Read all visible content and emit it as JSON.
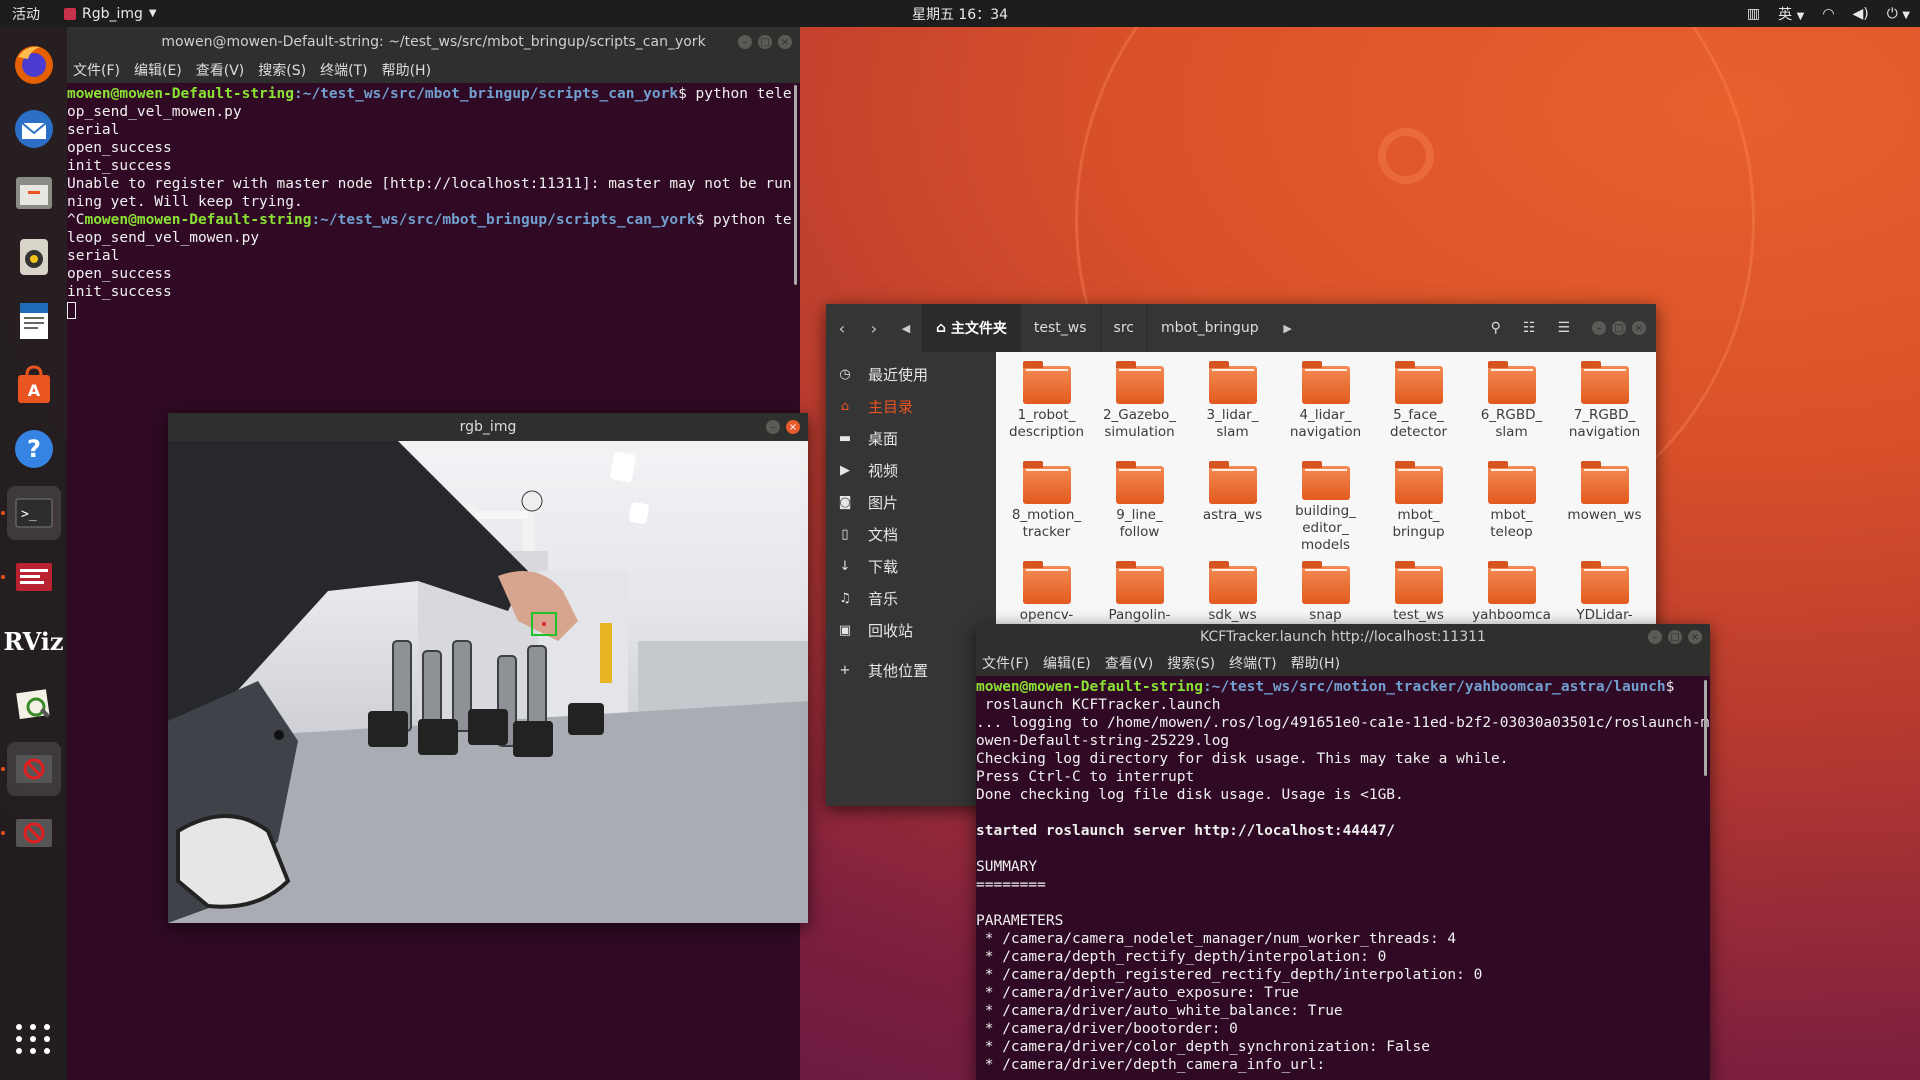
{
  "topbar": {
    "activities": "活动",
    "app_name": "Rgb_img",
    "clock": "星期五 16：34",
    "input_method": "英"
  },
  "dock": {
    "items": [
      "firefox-icon",
      "thunderbird-icon",
      "files-icon",
      "rhythmbox-icon",
      "writer-icon",
      "software-icon",
      "help-icon",
      "terminal-icon",
      "terminal-red-icon",
      "rviz-icon",
      "image-viewer-icon",
      "blocked-app-icon",
      "blocked-app-icon"
    ],
    "rviz_label": "RViz"
  },
  "terminal1": {
    "title": "mowen@mowen-Default-string: ~/test_ws/src/mbot_bringup/scripts_can_york",
    "menu": [
      "文件(F)",
      "编辑(E)",
      "查看(V)",
      "搜索(S)",
      "终端(T)",
      "帮助(H)"
    ],
    "prompt_user": "mowen@mowen-Default-string",
    "prompt_path": ":~/test_ws/src/mbot_bringup/scripts_can_york",
    "cmd1": "$ python teleop_send_vel_mowen.py",
    "lines1": [
      "serial",
      "open_success",
      "init_success",
      "Unable to register with master node [http://localhost:11311]: master may not be running yet. Will keep trying."
    ],
    "ctrl_c": "^C",
    "cmd2": "$ python teleop_send_vel_mowen.py",
    "lines2": [
      "serial",
      "open_success",
      "init_success"
    ]
  },
  "image_window": {
    "title": "rgb_img"
  },
  "files": {
    "breadcrumbs": [
      "主文件夹",
      "test_ws",
      "src",
      "mbot_bringup"
    ],
    "sidebar": [
      {
        "icon": "clock-icon",
        "label": "最近使用"
      },
      {
        "icon": "home-icon",
        "label": "主目录"
      },
      {
        "icon": "folder-icon",
        "label": "桌面"
      },
      {
        "icon": "video-icon",
        "label": "视频"
      },
      {
        "icon": "camera-icon",
        "label": "图片"
      },
      {
        "icon": "document-icon",
        "label": "文档"
      },
      {
        "icon": "download-icon",
        "label": "下载"
      },
      {
        "icon": "music-icon",
        "label": "音乐"
      },
      {
        "icon": "trash-icon",
        "label": "回收站"
      },
      {
        "icon": "plus-icon",
        "label": "其他位置"
      }
    ],
    "folders": [
      "1_robot_\ndescription",
      "2_Gazebo_\nsimulation",
      "3_lidar_\nslam",
      "4_lidar_\nnavigation",
      "5_face_\ndetector",
      "6_RGBD_\nslam",
      "7_RGBD_\nnavigation",
      "8_motion_\ntracker",
      "9_line_\nfollow",
      "astra_ws",
      "building_\neditor_\nmodels",
      "mbot_\nbringup",
      "mbot_\nteleop",
      "mowen_ws",
      "opencv-",
      "Pangolin-",
      "sdk_ws",
      "snap",
      "test_ws",
      "yahboomca",
      "YDLidar-"
    ]
  },
  "terminal2": {
    "title": "KCFTracker.launch http://localhost:11311",
    "menu": [
      "文件(F)",
      "编辑(E)",
      "查看(V)",
      "搜索(S)",
      "终端(T)",
      "帮助(H)"
    ],
    "prompt_user": "mowen@mowen-Default-string",
    "prompt_path": ":~/test_ws/src/motion_tracker/yahboomcar_astra/launch",
    "prompt_end": "$",
    "cmd": " roslaunch KCFTracker.launch",
    "log_lines": [
      "... logging to /home/mowen/.ros/log/491651e0-ca1e-11ed-b2f2-03030a03501c/roslaunch-mowen-Default-string-25229.log",
      "Checking log directory for disk usage. This may take a while.",
      "Press Ctrl-C to interrupt",
      "Done checking log file disk usage. Usage is <1GB."
    ],
    "server_line": "started roslaunch server http://localhost:44447/",
    "summary": "SUMMARY",
    "summary_rule": "========",
    "params_header": "PARAMETERS",
    "params": [
      " * /camera/camera_nodelet_manager/num_worker_threads: 4",
      " * /camera/depth_rectify_depth/interpolation: 0",
      " * /camera/depth_registered_rectify_depth/interpolation: 0",
      " * /camera/driver/auto_exposure: True",
      " * /camera/driver/auto_white_balance: True",
      " * /camera/driver/bootorder: 0",
      " * /camera/driver/color_depth_synchronization: False",
      " * /camera/driver/depth_camera_info_url:"
    ]
  }
}
